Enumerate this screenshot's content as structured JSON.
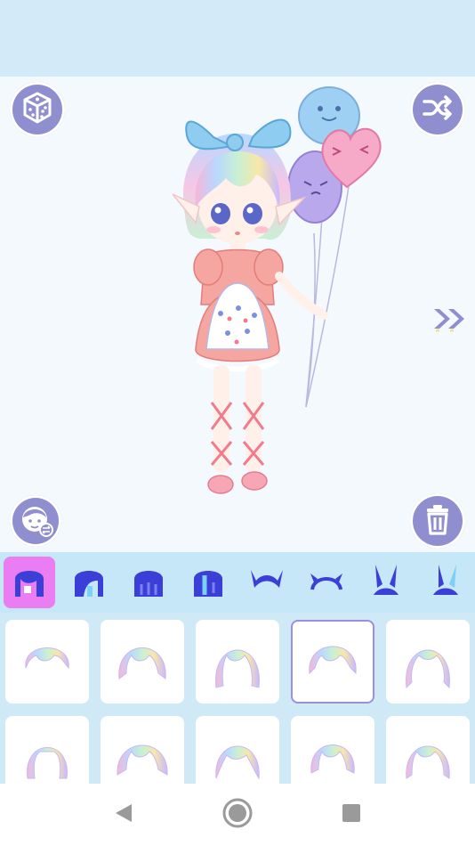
{
  "app": {
    "accent_color": "#8f8fcf",
    "selected_category_color": "#ea7df2"
  },
  "toolbar": {
    "top_left_icon": "dice-icon",
    "top_right_icon": "shuffle-icon",
    "bottom_left_icon": "swap-face-icon",
    "bottom_right_icon": "trash-icon",
    "next_icon": "double-chevron-right-icon"
  },
  "categories": {
    "selected_index": 0,
    "items": [
      {
        "icon": "hair-front-icon"
      },
      {
        "icon": "hair-side-icon"
      },
      {
        "icon": "hair-back-icon"
      },
      {
        "icon": "hair-long-icon"
      },
      {
        "icon": "horns-icon"
      },
      {
        "icon": "headband-horns-icon"
      },
      {
        "icon": "bunny-ears-icon"
      },
      {
        "icon": "bunny-ears-alt-icon"
      }
    ]
  },
  "hair_tiles": {
    "selected_index": 3,
    "items": [
      {
        "icon": "hair-style-1-icon"
      },
      {
        "icon": "hair-style-2-icon"
      },
      {
        "icon": "hair-style-3-icon"
      },
      {
        "icon": "hair-style-4-icon"
      },
      {
        "icon": "hair-style-5-icon"
      },
      {
        "icon": "hair-style-6-icon"
      },
      {
        "icon": "hair-style-7-icon"
      },
      {
        "icon": "hair-style-8-icon"
      },
      {
        "icon": "hair-style-9-icon"
      },
      {
        "icon": "hair-style-10-icon"
      }
    ]
  },
  "system_nav": {
    "back_icon": "back-triangle-icon",
    "home_icon": "home-circle-icon",
    "recents_icon": "recents-square-icon"
  }
}
